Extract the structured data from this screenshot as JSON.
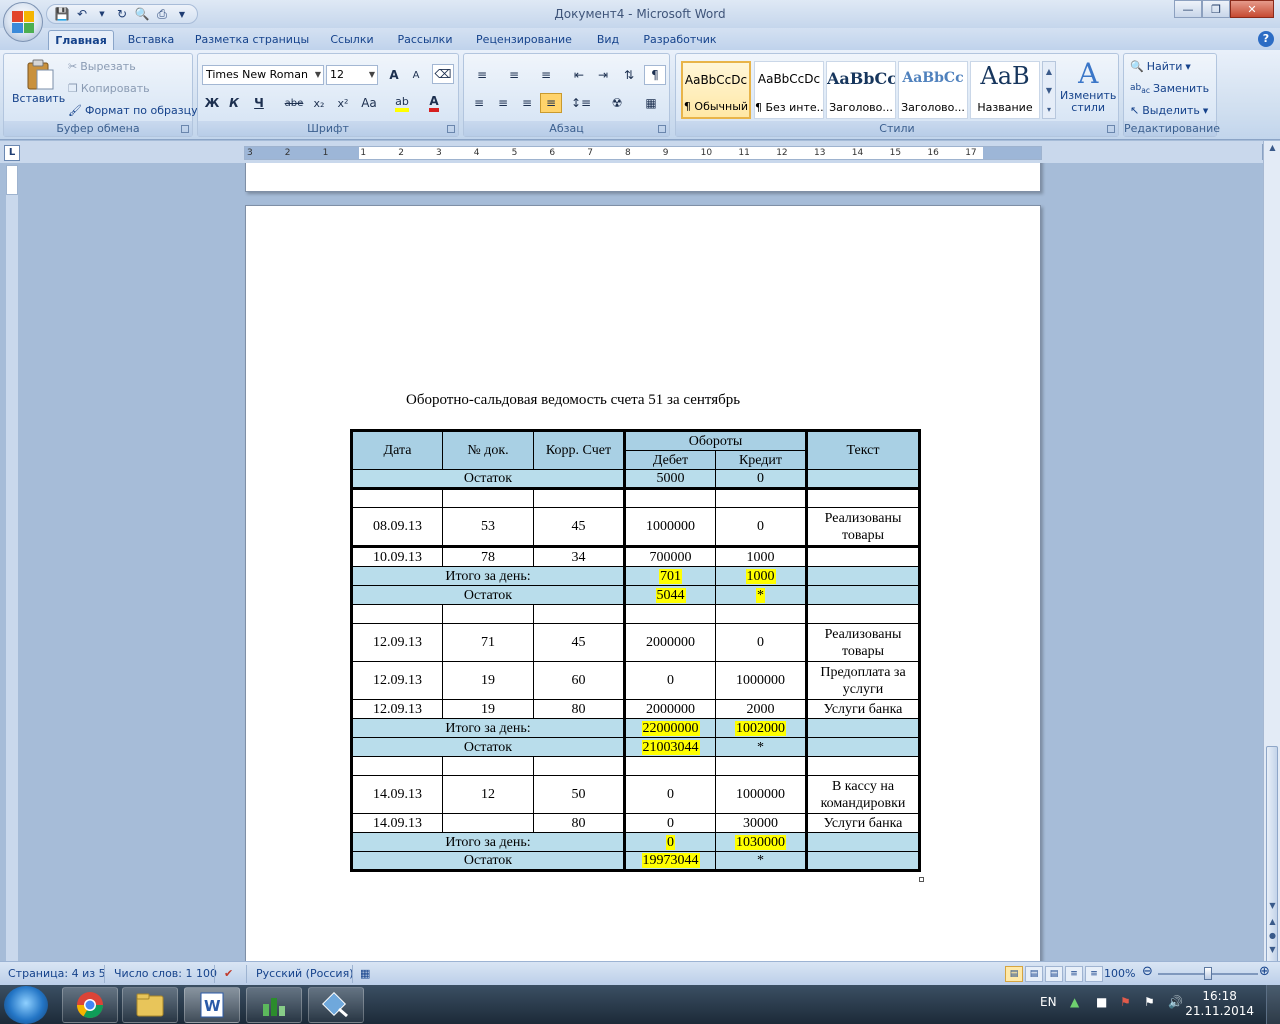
{
  "window": {
    "title": "Документ4 - Microsoft Word"
  },
  "tabs": [
    "Главная",
    "Вставка",
    "Разметка страницы",
    "Ссылки",
    "Рассылки",
    "Рецензирование",
    "Вид",
    "Разработчик"
  ],
  "active_tab": "Главная",
  "ribbon": {
    "clipboard": {
      "label": "Буфер обмена",
      "paste": "Вставить",
      "cut": "Вырезать",
      "copy": "Копировать",
      "format_painter": "Формат по образцу"
    },
    "font": {
      "label": "Шрифт",
      "font_name": "Times New Roman",
      "font_size": "12",
      "bold": "Ж",
      "italic": "К",
      "underline": "Ч",
      "strike": "abe",
      "sub": "x₂",
      "sup": "x²",
      "case": "Aa",
      "grow": "A",
      "shrink": "A"
    },
    "paragraph": {
      "label": "Абзац",
      "pilcrow": "¶"
    },
    "styles": {
      "label": "Стили",
      "items": [
        {
          "sample": "AaBbCcDc",
          "name": "¶ Обычный"
        },
        {
          "sample": "AaBbCcDc",
          "name": "¶ Без инте..."
        },
        {
          "sample": "AaBbCc",
          "name": "Заголово..."
        },
        {
          "sample": "AaBbCc",
          "name": "Заголово..."
        },
        {
          "sample": "AaB",
          "name": "Название"
        }
      ],
      "change_styles_line1": "Изменить",
      "change_styles_line2": "стили"
    },
    "editing": {
      "label": "Редактирование",
      "find": "Найти",
      "replace": "Заменить",
      "select": "Выделить"
    }
  },
  "ruler": {
    "numbers": [
      "3",
      "2",
      "1",
      "1",
      "2",
      "3",
      "4",
      "5",
      "6",
      "7",
      "8",
      "9",
      "10",
      "11",
      "12",
      "13",
      "14",
      "15",
      "16",
      "17"
    ]
  },
  "document": {
    "title": "Оборотно-сальдовая ведомость счета 51 за сентябрь",
    "table": {
      "headers": {
        "date": "Дата",
        "doc": "№ док.",
        "acc": "Корр. Счет",
        "turnover": "Обороты",
        "debit": "Дебет",
        "credit": "Кредит",
        "text": "Текст"
      },
      "balance_label": "Остаток",
      "day_total_label": "Итого за день:",
      "opening": {
        "debit": "5000",
        "credit": "0"
      },
      "r1": {
        "date": "08.09.13",
        "doc": "53",
        "acc": "45",
        "debit": "1000000",
        "credit": "0",
        "text": "Реализованы товары"
      },
      "r2": {
        "date": "10.09.13",
        "doc": "78",
        "acc": "34",
        "debit": "700000",
        "credit": "1000",
        "text": ""
      },
      "t1": {
        "debit": "701",
        "credit": "1000"
      },
      "b1": {
        "debit": "5044",
        "credit": "*"
      },
      "r3": {
        "date": "12.09.13",
        "doc": "71",
        "acc": "45",
        "debit": "2000000",
        "credit": "0",
        "text": "Реализованы товары"
      },
      "r4": {
        "date": "12.09.13",
        "doc": "19",
        "acc": "60",
        "debit": "0",
        "credit": "1000000",
        "text": "Предоплата за услуги"
      },
      "r5": {
        "date": "12.09.13",
        "doc": "19",
        "acc": "80",
        "debit": "2000000",
        "credit": "2000",
        "text": "Услуги банка"
      },
      "t2": {
        "debit": "22000000",
        "credit": "1002000"
      },
      "b2": {
        "debit": "21003044",
        "credit": "*"
      },
      "r6": {
        "date": "14.09.13",
        "doc": "12",
        "acc": "50",
        "debit": "0",
        "credit": "1000000",
        "text": "В кассу на командировки"
      },
      "r7": {
        "date": "14.09.13",
        "doc": "",
        "acc": "80",
        "debit": "0",
        "credit": "30000",
        "text": "Услуги банка"
      },
      "t3": {
        "debit": "0",
        "credit": "1030000"
      },
      "b3": {
        "debit": "19973044",
        "credit": "*"
      }
    }
  },
  "statusbar": {
    "page": "Страница: 4 из 5",
    "words": "Число слов: 1 100",
    "language": "Русский (Россия)",
    "zoom": "100%"
  },
  "taskbar": {
    "lang": "EN",
    "time": "16:18",
    "date": "21.11.2014"
  },
  "colors": {
    "table_header_bg": "#a9d0e4",
    "table_highlight": "#ffff00",
    "ribbon_text": "#15428b"
  }
}
